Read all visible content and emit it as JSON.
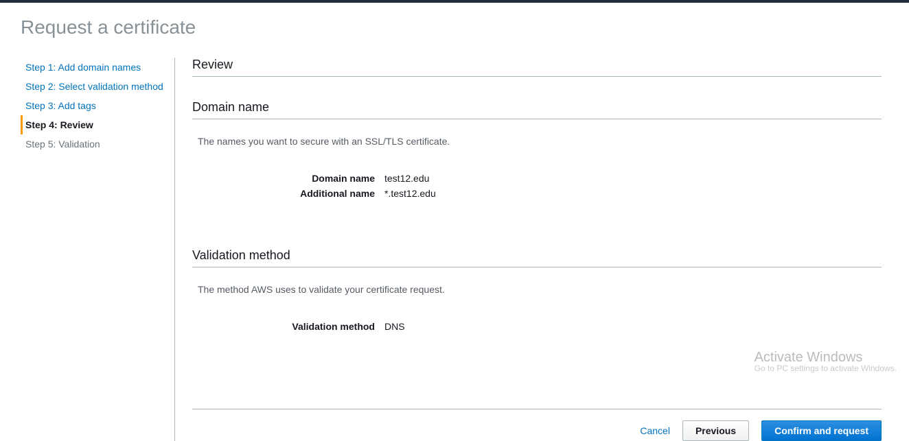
{
  "header": {
    "title": "Request a certificate"
  },
  "sidebar": {
    "steps": [
      {
        "label": "Step 1: Add domain names",
        "state": "past"
      },
      {
        "label": "Step 2: Select validation method",
        "state": "past"
      },
      {
        "label": "Step 3: Add tags",
        "state": "past"
      },
      {
        "label": "Step 4: Review",
        "state": "active"
      },
      {
        "label": "Step 5: Validation",
        "state": "after"
      }
    ]
  },
  "main": {
    "review_heading": "Review",
    "domain_section": {
      "title": "Domain name",
      "description": "The names you want to secure with an SSL/TLS certificate.",
      "rows": {
        "domain_name_label": "Domain name",
        "domain_name_value": "test12.edu",
        "additional_name_label": "Additional name",
        "additional_name_value": "*.test12.edu"
      }
    },
    "validation_section": {
      "title": "Validation method",
      "description": "The method AWS uses to validate your certificate request.",
      "rows": {
        "method_label": "Validation method",
        "method_value": "DNS"
      }
    },
    "actions": {
      "cancel": "Cancel",
      "previous": "Previous",
      "confirm": "Confirm and request"
    }
  },
  "watermark": {
    "line1": "Activate Windows",
    "line2": "Go to PC settings to activate Windows."
  }
}
